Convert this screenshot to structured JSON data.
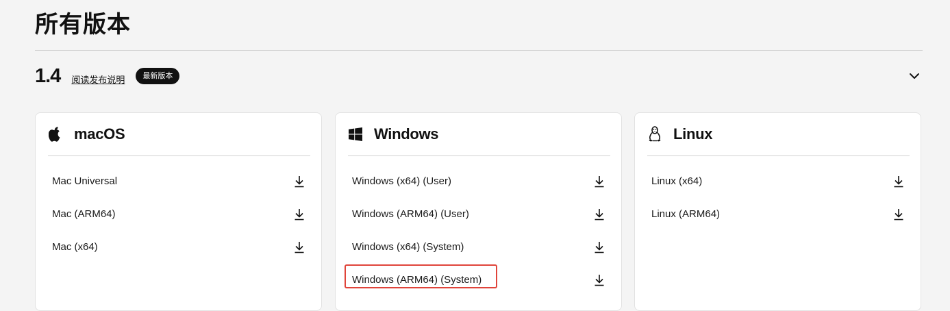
{
  "page": {
    "title": "所有版本"
  },
  "version": {
    "number": "1.4",
    "release_notes_label": "阅读发布说明",
    "badge": "最新版本",
    "toggle_icon": "chevron-down-icon"
  },
  "platforms": {
    "mac": {
      "name": "macOS",
      "icon": "apple-icon",
      "downloads": [
        "Mac Universal",
        "Mac (ARM64)",
        "Mac (x64)"
      ]
    },
    "windows": {
      "name": "Windows",
      "icon": "windows-icon",
      "downloads": [
        "Windows (x64) (User)",
        "Windows (ARM64) (User)",
        "Windows (x64) (System)",
        "Windows (ARM64) (System)"
      ]
    },
    "linux": {
      "name": "Linux",
      "icon": "linux-icon",
      "downloads": [
        "Linux (x64)",
        "Linux (ARM64)"
      ]
    }
  },
  "colors": {
    "background": "#f4f4f4",
    "card": "#ffffff",
    "badge_bg": "#111111",
    "highlight": "#e0443a"
  }
}
